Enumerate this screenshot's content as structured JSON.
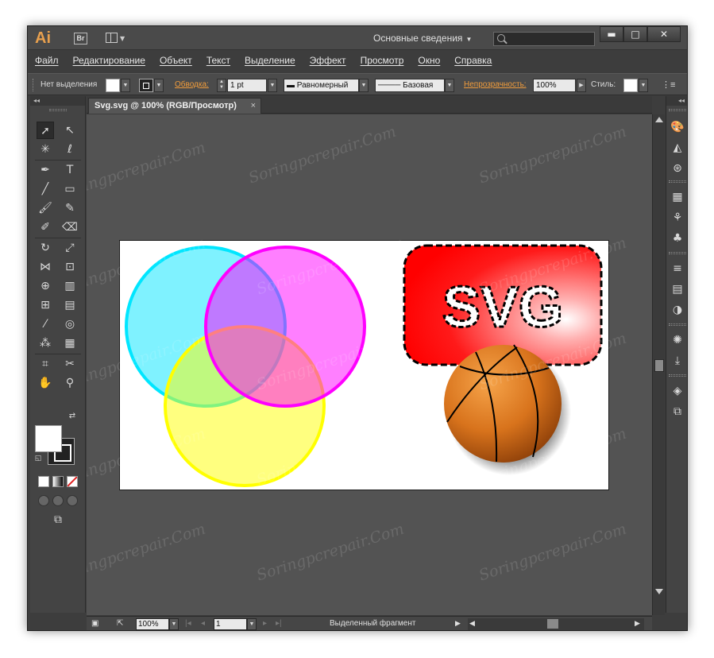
{
  "app": {
    "logo": "Ai",
    "bridge": "Br"
  },
  "titlebar": {
    "workspace": "Основные сведения",
    "search_placeholder": ""
  },
  "window_controls": {
    "minimize": "▬",
    "maximize": "□",
    "close": "✕"
  },
  "menu": [
    "Файл",
    "Редактирование",
    "Объект",
    "Текст",
    "Выделение",
    "Эффект",
    "Просмотр",
    "Окно",
    "Справка"
  ],
  "control_bar": {
    "selection": "Нет выделения",
    "stroke_label": "Обводка:",
    "stroke_weight": "1 pt",
    "profile": "Равномерный",
    "brush": "Базовая",
    "opacity_label": "Непрозрачность:",
    "opacity_value": "100%",
    "style_label": "Стиль:"
  },
  "document": {
    "tab_title": "Svg.svg @ 100% (RGB/Просмотр)",
    "tab_close": "×"
  },
  "artwork": {
    "badge_text": "SVG",
    "colors": {
      "cyan": "#00e6ff",
      "magenta": "#ff00ff",
      "yellow": "#ffff00",
      "badge_red": "#ff0000",
      "ball_orange": "#e07a1a"
    }
  },
  "statusbar": {
    "zoom": "100%",
    "artboard": "1",
    "status": "Выделенный фрагмент"
  },
  "watermark": "Soringpcrepair.Com"
}
